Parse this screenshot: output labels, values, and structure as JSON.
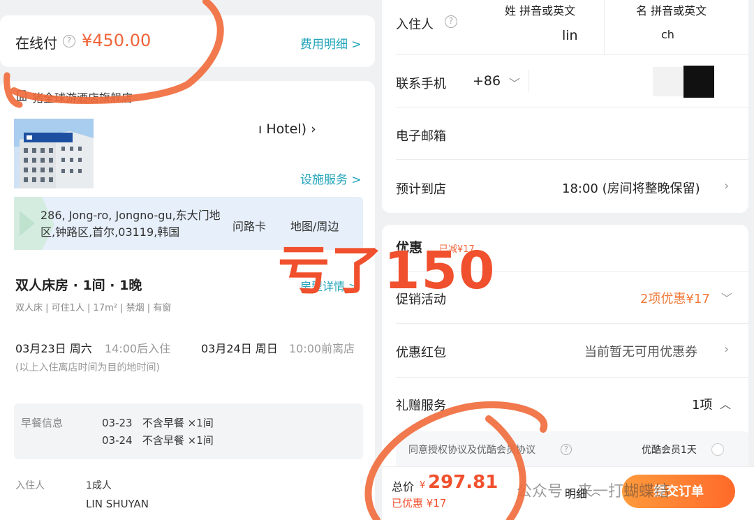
{
  "payment": {
    "label": "在线付",
    "help_icon": "question-circle-icon",
    "amount": "¥450.00",
    "fee_detail_link": "费用明细 >"
  },
  "hotel": {
    "store_icon": "shop-icon",
    "store_name": "猪全球游酒店旗舰店",
    "name_visible": "ı Hotel) ›",
    "facility_link": "设施服务 >",
    "address": "286, Jong-ro, Jongno-gu,东大门地区,钟路区,首尔,03119,韩国",
    "route_card": "问路卡",
    "map_nearby": "地图/周边"
  },
  "room": {
    "title": "双人床房 · 1间 · 1晚",
    "detail_link": "房型详情 >",
    "specs": "双人床 | 可住1人 | 17m² | 禁烟 | 有窗",
    "checkin_date": "03月23日 周六",
    "checkin_time": "14:00后入住",
    "checkout_date": "03月24日 周日",
    "checkout_time": "10:00前离店",
    "time_note": "(以上入住离店时间为目的地时间)"
  },
  "breakfast": {
    "label": "早餐信息",
    "rows": [
      "03-23   不含早餐 ×1间",
      "03-24   不含早餐 ×1间"
    ]
  },
  "guests": {
    "label": "入住人",
    "count": "1成人",
    "name": "LIN SHUYAN"
  },
  "form": {
    "occupant_label": "入住人",
    "surname_header": "姓 拼音或英文",
    "surname_value": "lin",
    "given_header": "名 拼音或英文",
    "given_value": "ch",
    "phone_label": "联系手机",
    "phone_code": "+86",
    "email_label": "电子邮箱",
    "arrival_label": "预计到店",
    "arrival_value": "18:00 (房间将整晚保留)"
  },
  "promotions": {
    "title": "优惠",
    "applied": "已减¥17",
    "promo_label": "促销活动",
    "promo_value": "2项优惠¥17",
    "coupon_label": "优惠红包",
    "coupon_value": "当前暂无可用优惠券",
    "gift_label": "礼赠服务",
    "gift_value": "1项",
    "agree_text": "同意授权协议及优酷会员协议",
    "member_text": "优酷会员1天"
  },
  "footer": {
    "total_label": "总价",
    "currency": "¥",
    "total_amount": "297.81",
    "saved": "已优惠 ¥17",
    "detail": "明细",
    "submit": "提交订单",
    "watermark": "公众号 · 来一打蝴蝶结"
  },
  "overlay": {
    "annotation": "亏了150"
  },
  "colors": {
    "accent_blue": "#1fa3b8",
    "price_orange": "#f0502d",
    "submit_gradient_start": "#ff9a3c",
    "submit_gradient_end": "#ff6a2a"
  }
}
